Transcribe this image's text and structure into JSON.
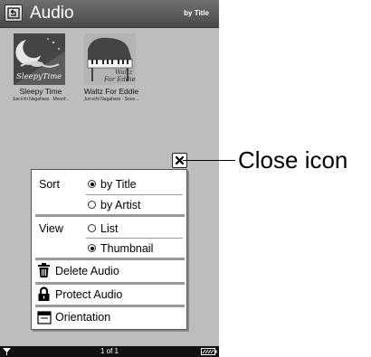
{
  "header": {
    "title": "Audio",
    "sort_indicator": "by Title"
  },
  "albums": [
    {
      "title": "Sleepy Time",
      "artist": "Jun-ichi Nagahara · Moonf...",
      "cover_text": "SleepyTime"
    },
    {
      "title": "Waltz For Eddie",
      "artist": "Jun-ichi Nagahara · Soun...",
      "cover_text_1": "Waltz",
      "cover_text_2": "For Eddie"
    }
  ],
  "options_menu": {
    "sort": {
      "label": "Sort",
      "options": [
        "by Title",
        "by Artist"
      ],
      "selected": "by Title"
    },
    "view": {
      "label": "View",
      "options": [
        "List",
        "Thumbnail"
      ],
      "selected": "Thumbnail"
    },
    "actions": [
      {
        "label": "Delete Audio",
        "icon": "trash-icon"
      },
      {
        "label": "Protect Audio",
        "icon": "lock-icon"
      },
      {
        "label": "Orientation",
        "icon": "orientation-icon"
      }
    ]
  },
  "status_bar": {
    "page_indicator": "1 of 1"
  },
  "annotation": {
    "callout": "Close icon"
  }
}
